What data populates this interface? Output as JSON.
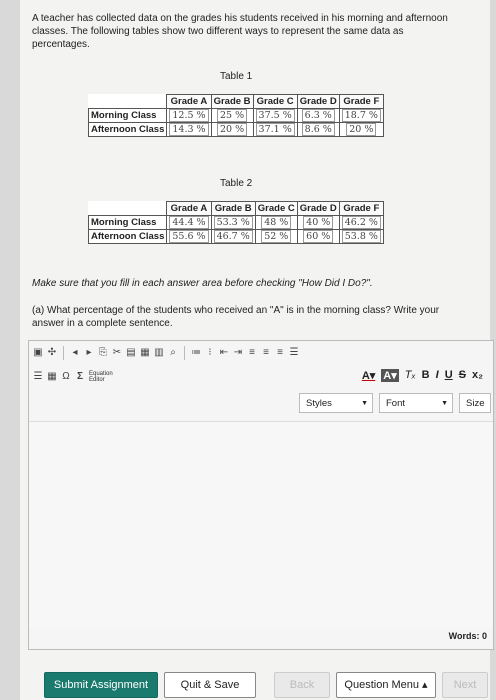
{
  "intro": "A teacher has collected data on the grades his students received in his morning and afternoon classes. The following tables show two different ways to represent the same data as percentages.",
  "table1": {
    "caption": "Table 1",
    "headers": [
      "",
      "Grade A",
      "Grade B",
      "Grade C",
      "Grade D",
      "Grade F"
    ],
    "rows": [
      {
        "label": "Morning Class",
        "values": [
          "12.5 %",
          "25 %",
          "37.5 %",
          "6.3 %",
          "18.7 %"
        ]
      },
      {
        "label": "Afternoon Class",
        "values": [
          "14.3 %",
          "20 %",
          "37.1 %",
          "8.6 %",
          "20 %"
        ]
      }
    ]
  },
  "table2": {
    "caption": "Table 2",
    "headers": [
      "",
      "Grade A",
      "Grade B",
      "Grade C",
      "Grade D",
      "Grade F"
    ],
    "rows": [
      {
        "label": "Morning Class",
        "values": [
          "44.4 %",
          "53.3 %",
          "48 %",
          "40 %",
          "46.2 %"
        ]
      },
      {
        "label": "Afternoon Class",
        "values": [
          "55.6 %",
          "46.7 %",
          "52 %",
          "60 %",
          "53.8 %"
        ]
      }
    ]
  },
  "note": "Make sure that you fill in each answer area before checking \"How Did I Do?\".",
  "question": "(a) What percentage of the students who received an \"A\" is in the morning class? Write your answer in a complete sentence.",
  "editor": {
    "equation_label_1": "Equation",
    "equation_label_2": "Editor",
    "styles": "Styles",
    "font": "Font",
    "size": "Size",
    "words": "Words: 0",
    "fmt_bold": "B",
    "fmt_italic": "I",
    "fmt_underline": "U",
    "fmt_strike": "S",
    "fmt_sub": "x₂"
  },
  "buttons": {
    "submit": "Submit Assignment",
    "quit": "Quit & Save",
    "back": "Back",
    "menu": "Question Menu ▴",
    "next": "Next"
  }
}
